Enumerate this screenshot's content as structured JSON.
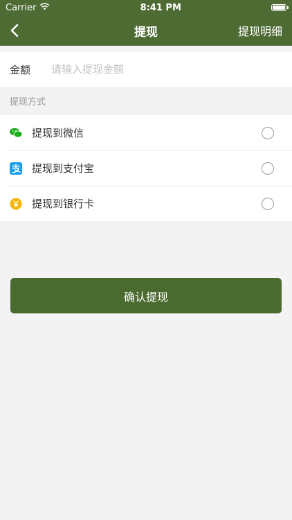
{
  "status_bar": {
    "carrier": "Carrier",
    "time": "8:41 PM"
  },
  "nav": {
    "title": "提现",
    "right_label": "提现明细",
    "back_icon": "chevron-left-icon"
  },
  "amount": {
    "label": "金额",
    "value": "",
    "placeholder": "请输入提现金额"
  },
  "section_title": "提现方式",
  "methods": [
    {
      "icon": "wechat-icon",
      "label": "提现到微信",
      "color": "#1aad19"
    },
    {
      "icon": "alipay-icon",
      "label": "提现到支付宝",
      "color": "#1a9fe8"
    },
    {
      "icon": "yuan-coin-icon",
      "label": "提现到银行卡",
      "color": "#f4b400"
    }
  ],
  "confirm_label": "确认提现",
  "colors": {
    "brand": "#4d6b33",
    "button": "#4a6a30",
    "background": "#f3f3f3"
  }
}
